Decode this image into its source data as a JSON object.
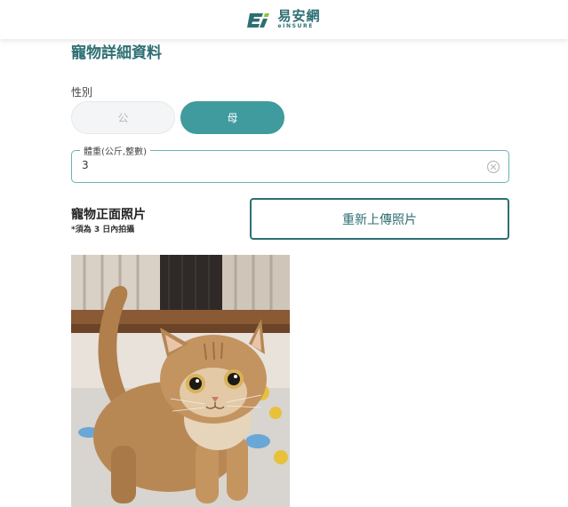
{
  "header": {
    "logo_cn": "易安網",
    "logo_en": "eINSURE"
  },
  "section": {
    "title": "寵物詳細資料"
  },
  "gender": {
    "label": "性別",
    "options": [
      "公",
      "母"
    ],
    "selected": "母"
  },
  "weight": {
    "legend": "體重(公斤,整數)",
    "value": "3"
  },
  "photo": {
    "title": "寵物正面照片",
    "note": "*須為 3 日內拍攝",
    "reupload_label": "重新上傳照片"
  },
  "colors": {
    "brand": "#2e6f73",
    "selected_bg": "#3f9b9d",
    "field_border": "#6bb2b3"
  }
}
